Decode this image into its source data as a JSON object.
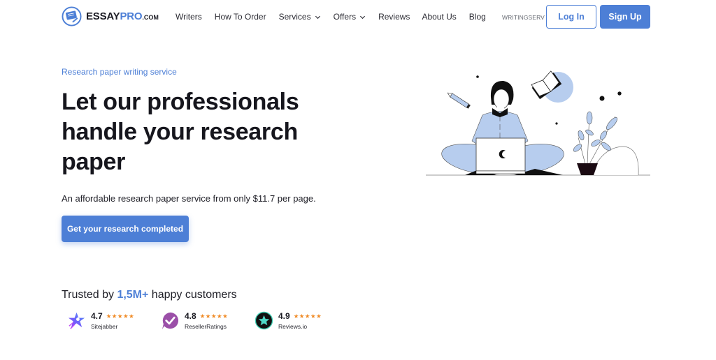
{
  "header": {
    "logo": {
      "main": "ESSAY",
      "accent": "PRO",
      "suffix": ".COM"
    },
    "nav": [
      {
        "label": "Writers",
        "has_dropdown": false
      },
      {
        "label": "How To Order",
        "has_dropdown": false
      },
      {
        "label": "Services",
        "has_dropdown": true
      },
      {
        "label": "Offers",
        "has_dropdown": true
      },
      {
        "label": "Reviews",
        "has_dropdown": false
      },
      {
        "label": "About Us",
        "has_dropdown": false
      },
      {
        "label": "Blog",
        "has_dropdown": false
      }
    ],
    "partner_label": "WRITINGSERV",
    "login_label": "Log In",
    "signup_label": "Sign Up"
  },
  "hero": {
    "eyebrow": "Research paper writing service",
    "headline": "Let our professionals handle your research paper",
    "subtext": "An affordable research paper service from only $11.7 per page.",
    "cta_label": "Get your research completed",
    "illustration": "woman-with-laptop-book-plant-illustration"
  },
  "trust": {
    "prefix": "Trusted by ",
    "highlight": "1,5M+",
    "suffix": " happy customers",
    "ratings": [
      {
        "score": "4.7",
        "stars": "★★★★★",
        "source": "Sitejabber",
        "icon": "sitejabber-rocket-icon"
      },
      {
        "score": "4.8",
        "stars": "★★★★★",
        "source": "ResellerRatings",
        "icon": "resellerratings-check-icon"
      },
      {
        "score": "4.9",
        "stars": "★★★★★",
        "source": "Reviews.io",
        "icon": "reviewsio-star-icon"
      }
    ]
  },
  "colors": {
    "brand_blue": "#4d7fd6",
    "illustration_blue": "#b7cdee",
    "star_orange": "#f08a24",
    "text_dark": "#16161d"
  }
}
